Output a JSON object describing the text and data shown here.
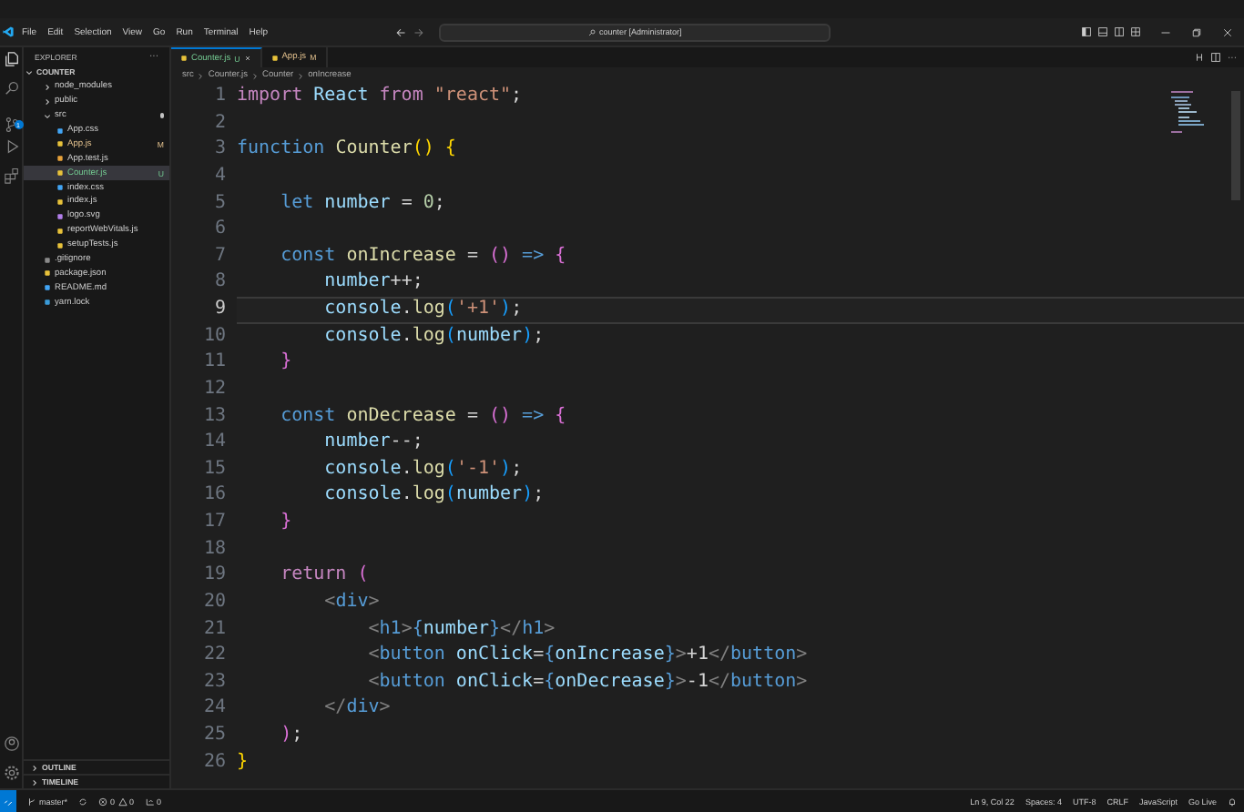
{
  "title_bar": {
    "menu": [
      "File",
      "Edit",
      "Selection",
      "View",
      "Go",
      "Run",
      "Terminal",
      "Help"
    ],
    "search": "counter [Administrator]"
  },
  "activity_bar": {
    "scm_badge": "1"
  },
  "sidebar": {
    "title": "EXPLORER",
    "more": "···",
    "tree": {
      "label": "COUNTER",
      "expanded": true,
      "children": [
        {
          "label": "node_modules",
          "kind": "folder",
          "expanded": false,
          "selected": false
        },
        {
          "label": "public",
          "kind": "folder",
          "expanded": false,
          "selected": false
        },
        {
          "label": "src",
          "kind": "folder",
          "expanded": true,
          "selected": false,
          "changes": true,
          "children": [
            {
              "label": "App.css",
              "kind": "css",
              "selected": false
            },
            {
              "label": "App.js",
              "kind": "js",
              "selected": false,
              "status": "M"
            },
            {
              "label": "App.test.js",
              "kind": "test",
              "selected": false
            },
            {
              "label": "Counter.js",
              "kind": "js",
              "selected": true,
              "status": "U"
            },
            {
              "label": "index.css",
              "kind": "css",
              "selected": false
            },
            {
              "label": "index.js",
              "kind": "js",
              "selected": false
            },
            {
              "label": "logo.svg",
              "kind": "svg",
              "selected": false
            },
            {
              "label": "reportWebVitals.js",
              "kind": "js",
              "selected": false
            },
            {
              "label": "setupTests.js",
              "kind": "js",
              "selected": false
            }
          ]
        },
        {
          "label": ".gitignore",
          "kind": "git",
          "selected": false
        },
        {
          "label": "package.json",
          "kind": "json",
          "selected": false
        },
        {
          "label": "README.md",
          "kind": "md",
          "selected": false
        },
        {
          "label": "yarn.lock",
          "kind": "yarn",
          "selected": false
        }
      ]
    },
    "sections": [
      {
        "label": "OUTLINE",
        "expanded": false
      },
      {
        "label": "TIMELINE",
        "expanded": false
      }
    ]
  },
  "tabs": [
    {
      "label": "Counter.js",
      "status": "U",
      "selected": true
    },
    {
      "label": "App.js",
      "status": "M",
      "selected": false
    }
  ],
  "breadcrumbs": [
    "src",
    "Counter.js",
    "Counter",
    "onIncrease"
  ],
  "editor": {
    "lines": [
      {
        "number": "1",
        "current": false,
        "tokens": [
          {
            "kind": "kw",
            "text": "import"
          },
          {
            "kind": "var",
            "text": " React"
          },
          {
            "kind": "kw",
            "text": " from"
          },
          {
            "kind": "str",
            "text": " \"react\""
          },
          {
            "kind": "p",
            "text": ";"
          }
        ]
      },
      {
        "number": "2",
        "current": false
      },
      {
        "number": "3",
        "current": false,
        "tokens": [
          {
            "kind": "decl",
            "text": "function"
          },
          {
            "kind": "fn",
            "text": " Counter"
          },
          {
            "kind": "b1",
            "text": "()"
          },
          {
            "kind": "b1",
            "text": " {"
          }
        ]
      },
      {
        "number": "4",
        "current": false
      },
      {
        "number": "5",
        "current": false,
        "tokens": [
          {
            "kind": "decl",
            "text": "    let"
          },
          {
            "kind": "var",
            "text": " number"
          },
          {
            "kind": "p",
            "text": " ="
          },
          {
            "kind": "num",
            "text": " 0"
          },
          {
            "kind": "p",
            "text": ";"
          }
        ]
      },
      {
        "number": "6",
        "current": false
      },
      {
        "number": "7",
        "current": false,
        "tokens": [
          {
            "kind": "decl",
            "text": "    const"
          },
          {
            "kind": "fn",
            "text": " onIncrease"
          },
          {
            "kind": "p",
            "text": " ="
          },
          {
            "kind": "b2",
            "text": " ()"
          },
          {
            "kind": "decl",
            "text": " =>"
          },
          {
            "kind": "b2",
            "text": " {"
          }
        ]
      },
      {
        "number": "8",
        "current": false,
        "tokens": [
          {
            "kind": "var",
            "text": "        number"
          },
          {
            "kind": "p",
            "text": "++;"
          }
        ]
      },
      {
        "number": "9",
        "current": true,
        "tokens": [
          {
            "kind": "var",
            "text": "        console"
          },
          {
            "kind": "p",
            "text": "."
          },
          {
            "kind": "fn",
            "text": "log"
          },
          {
            "kind": "b3",
            "text": "("
          },
          {
            "kind": "str",
            "text": "'+1'"
          },
          {
            "kind": "b3",
            "text": ")"
          },
          {
            "kind": "p",
            "text": ";"
          }
        ]
      },
      {
        "number": "10",
        "current": false,
        "tokens": [
          {
            "kind": "var",
            "text": "        console"
          },
          {
            "kind": "p",
            "text": "."
          },
          {
            "kind": "fn",
            "text": "log"
          },
          {
            "kind": "b3",
            "text": "("
          },
          {
            "kind": "var",
            "text": "number"
          },
          {
            "kind": "b3",
            "text": ")"
          },
          {
            "kind": "p",
            "text": ";"
          }
        ]
      },
      {
        "number": "11",
        "current": false,
        "tokens": [
          {
            "kind": "b2",
            "text": "    }"
          }
        ]
      },
      {
        "number": "12",
        "current": false
      },
      {
        "number": "13",
        "current": false,
        "tokens": [
          {
            "kind": "decl",
            "text": "    const"
          },
          {
            "kind": "fn",
            "text": " onDecrease"
          },
          {
            "kind": "p",
            "text": " ="
          },
          {
            "kind": "b2",
            "text": " ()"
          },
          {
            "kind": "decl",
            "text": " =>"
          },
          {
            "kind": "b2",
            "text": " {"
          }
        ]
      },
      {
        "number": "14",
        "current": false,
        "tokens": [
          {
            "kind": "var",
            "text": "        number"
          },
          {
            "kind": "p",
            "text": "--;"
          }
        ]
      },
      {
        "number": "15",
        "current": false,
        "tokens": [
          {
            "kind": "var",
            "text": "        console"
          },
          {
            "kind": "p",
            "text": "."
          },
          {
            "kind": "fn",
            "text": "log"
          },
          {
            "kind": "b3",
            "text": "("
          },
          {
            "kind": "str",
            "text": "'-1'"
          },
          {
            "kind": "b3",
            "text": ")"
          },
          {
            "kind": "p",
            "text": ";"
          }
        ]
      },
      {
        "number": "16",
        "current": false,
        "tokens": [
          {
            "kind": "var",
            "text": "        console"
          },
          {
            "kind": "p",
            "text": "."
          },
          {
            "kind": "fn",
            "text": "log"
          },
          {
            "kind": "b3",
            "text": "("
          },
          {
            "kind": "var",
            "text": "number"
          },
          {
            "kind": "b3",
            "text": ")"
          },
          {
            "kind": "p",
            "text": ";"
          }
        ]
      },
      {
        "number": "17",
        "current": false,
        "tokens": [
          {
            "kind": "b2",
            "text": "    }"
          }
        ]
      },
      {
        "number": "18",
        "current": false
      },
      {
        "number": "19",
        "current": false,
        "tokens": [
          {
            "kind": "kw",
            "text": "    return"
          },
          {
            "kind": "b2",
            "text": " ("
          }
        ]
      },
      {
        "number": "20",
        "current": false,
        "tokens": [
          {
            "kind": "ang",
            "text": "        <"
          },
          {
            "kind": "decl",
            "text": "div"
          },
          {
            "kind": "ang",
            "text": ">"
          }
        ]
      },
      {
        "number": "21",
        "current": false,
        "tokens": [
          {
            "kind": "ang",
            "text": "            <"
          },
          {
            "kind": "decl",
            "text": "h1"
          },
          {
            "kind": "ang",
            "text": ">"
          },
          {
            "kind": "decl",
            "text": "{"
          },
          {
            "kind": "var",
            "text": "number"
          },
          {
            "kind": "decl",
            "text": "}"
          },
          {
            "kind": "ang",
            "text": "</"
          },
          {
            "kind": "decl",
            "text": "h1"
          },
          {
            "kind": "ang",
            "text": ">"
          }
        ]
      },
      {
        "number": "22",
        "current": false,
        "tokens": [
          {
            "kind": "ang",
            "text": "            <"
          },
          {
            "kind": "decl",
            "text": "button"
          },
          {
            "kind": "var",
            "text": " onClick"
          },
          {
            "kind": "p",
            "text": "="
          },
          {
            "kind": "decl",
            "text": "{"
          },
          {
            "kind": "var",
            "text": "onIncrease"
          },
          {
            "kind": "decl",
            "text": "}"
          },
          {
            "kind": "ang",
            "text": ">"
          },
          {
            "kind": "p",
            "text": "+1"
          },
          {
            "kind": "ang",
            "text": "</"
          },
          {
            "kind": "decl",
            "text": "button"
          },
          {
            "kind": "ang",
            "text": ">"
          }
        ]
      },
      {
        "number": "23",
        "current": false,
        "tokens": [
          {
            "kind": "ang",
            "text": "            <"
          },
          {
            "kind": "decl",
            "text": "button"
          },
          {
            "kind": "var",
            "text": " onClick"
          },
          {
            "kind": "p",
            "text": "="
          },
          {
            "kind": "decl",
            "text": "{"
          },
          {
            "kind": "var",
            "text": "onDecrease"
          },
          {
            "kind": "decl",
            "text": "}"
          },
          {
            "kind": "ang",
            "text": ">"
          },
          {
            "kind": "p",
            "text": "-1"
          },
          {
            "kind": "ang",
            "text": "</"
          },
          {
            "kind": "decl",
            "text": "button"
          },
          {
            "kind": "ang",
            "text": ">"
          }
        ]
      },
      {
        "number": "24",
        "current": false,
        "tokens": [
          {
            "kind": "ang",
            "text": "        </"
          },
          {
            "kind": "decl",
            "text": "div"
          },
          {
            "kind": "ang",
            "text": ">"
          }
        ]
      },
      {
        "number": "25",
        "current": false,
        "tokens": [
          {
            "kind": "b2",
            "text": "    )"
          },
          {
            "kind": "p",
            "text": ";"
          }
        ]
      },
      {
        "number": "26",
        "current": false,
        "tokens": [
          {
            "kind": "b1",
            "text": "}"
          }
        ]
      }
    ]
  },
  "status_bar": {
    "branch": "master*",
    "errors": "0",
    "warnings": "0",
    "ports": "0",
    "position": "Ln 9, Col 22",
    "indent": "Spaces: 4",
    "encoding": "UTF-8",
    "eol": "CRLF",
    "language": "JavaScript",
    "golive": "Go Live"
  }
}
